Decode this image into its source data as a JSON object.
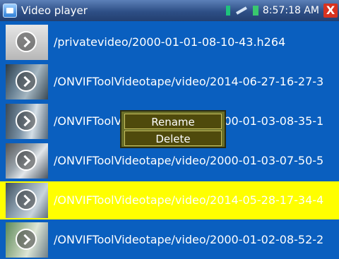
{
  "titlebar": {
    "title": "Video player",
    "clock": "8:57:18 AM",
    "close_label": "X",
    "icons": [
      "app-icon",
      "sim-icon",
      "usb-icon",
      "battery-icon",
      "close-icon"
    ]
  },
  "files": [
    {
      "name": "/privatevideo/2000-01-01-08-10-43.h264",
      "selected": false
    },
    {
      "name": "/ONVIFToolVideotape/video/2014-06-27-16-27-3",
      "selected": false
    },
    {
      "name": "/ONVIFToolVideotape/video/2000-01-03-08-35-1",
      "selected": false
    },
    {
      "name": "/ONVIFToolVideotape/video/2000-01-03-07-50-5",
      "selected": false
    },
    {
      "name": "/ONVIFToolVideotape/video/2014-05-28-17-34-4",
      "selected": true
    },
    {
      "name": "/ONVIFToolVideotape/video/2000-01-02-08-52-2",
      "selected": false
    }
  ],
  "context_menu": {
    "rename": "Rename",
    "delete": "Delete"
  },
  "colors": {
    "background": "#0a5fbf",
    "selected_row": "#ffff00",
    "menu_bg": "#4f4a0c"
  }
}
